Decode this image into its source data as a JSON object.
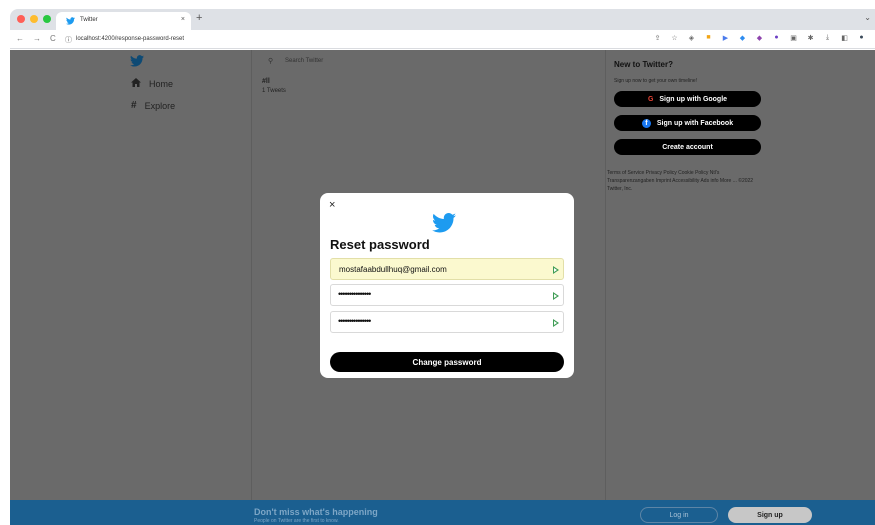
{
  "browser": {
    "tab_title": "Twitter",
    "tab_close": "×",
    "new_tab": "+",
    "tab_overflow": "⌄",
    "url": "localhost:4200/response-password-reset",
    "nav": {
      "back": "←",
      "forward": "→",
      "reload": "C"
    },
    "colors": {
      "close": "#ff5f57",
      "minimize": "#febc2e",
      "maximize": "#28c840"
    }
  },
  "sidebar": {
    "items": [
      {
        "label": "Home",
        "icon": "home-icon"
      },
      {
        "label": "Explore",
        "icon": "hashtag-icon"
      }
    ]
  },
  "search": {
    "placeholder": "Search Twitter"
  },
  "trend": {
    "tag": "#ll",
    "count": "1 Tweets"
  },
  "right": {
    "title": "New to Twitter?",
    "subtitle": "Sign up now to get your own timeline!",
    "google": "Sign up with Google",
    "facebook": "Sign up with Facebook",
    "create": "Create account",
    "footer": "Terms of Service  Privacy Policy  Cookie Policy  Ntl's Transparenzangaben  Imprint  Accessibility  Ads info  More ...  ©2022 Twitter, Inc."
  },
  "banner": {
    "title": "Don't miss what's happening",
    "subtitle": "People on Twitter are the first to know.",
    "login": "Log in",
    "signup": "Sign up"
  },
  "modal": {
    "close": "×",
    "title": "Reset password",
    "email": "mostafaabdullhuq@gmail.com",
    "password_mask": "•••••••••••••••",
    "confirm_mask": "•••••••••••••••",
    "submit": "Change password"
  }
}
